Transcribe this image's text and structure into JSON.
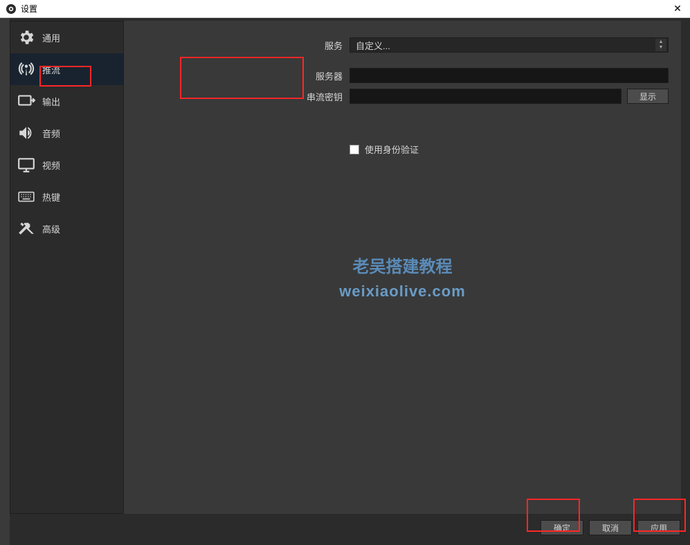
{
  "window": {
    "title": "设置"
  },
  "sidebar": {
    "items": [
      {
        "label": "通用"
      },
      {
        "label": "推流"
      },
      {
        "label": "输出"
      },
      {
        "label": "音频"
      },
      {
        "label": "视频"
      },
      {
        "label": "热键"
      },
      {
        "label": "高级"
      }
    ]
  },
  "form": {
    "service_label": "服务",
    "service_value": "自定义...",
    "server_label": "服务器",
    "server_value": "",
    "key_label": "串流密钥",
    "key_value": "",
    "show_button": "显示",
    "use_auth_label": "使用身份验证"
  },
  "watermark": {
    "line1": "老吴搭建教程",
    "line2": "weixiaolive.com"
  },
  "footer": {
    "ok": "确定",
    "cancel": "取消",
    "apply": "应用"
  }
}
